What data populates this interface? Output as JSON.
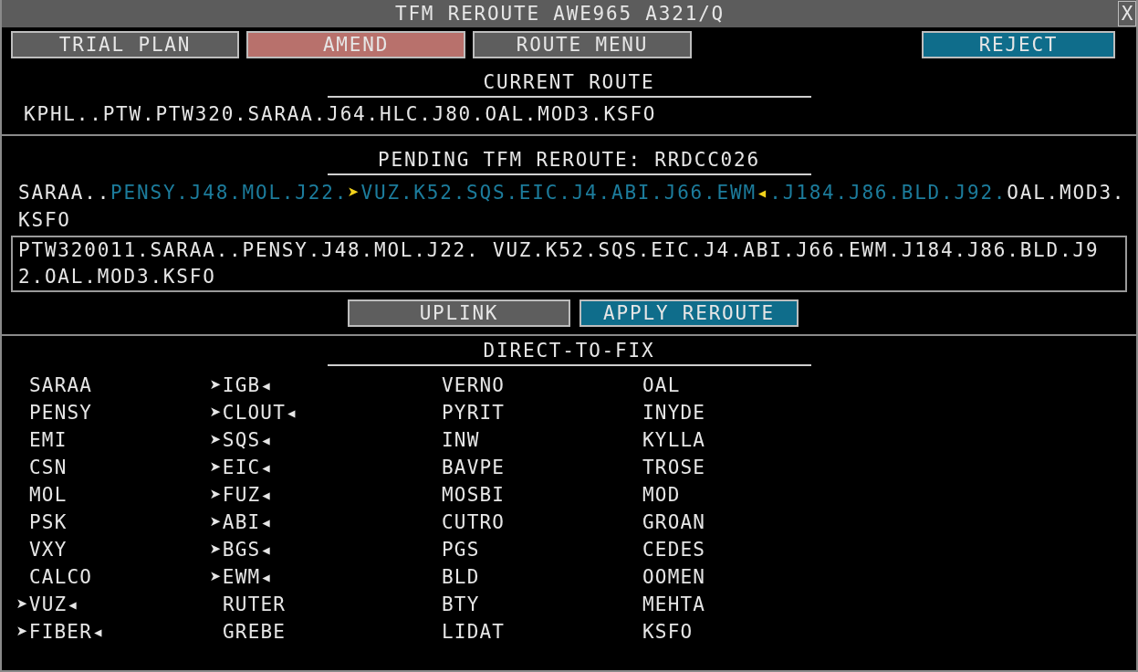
{
  "window": {
    "title": "TFM REROUTE AWE965 A321/Q",
    "close": "X"
  },
  "buttons": [
    {
      "label": "TRIAL PLAN",
      "kind": "grey"
    },
    {
      "label": "AMEND",
      "kind": "red"
    },
    {
      "label": "ROUTE MENU",
      "kind": "grey"
    },
    {
      "label": "REJECT",
      "kind": "blue"
    }
  ],
  "current_route": {
    "heading": "CURRENT ROUTE",
    "route": "KPHL..PTW.PTW320.SARAA.J64.HLC.J80.OAL.MOD3.KSFO"
  },
  "pending_reroute": {
    "heading": "PENDING TFM REROUTE: RRDCC026",
    "segments": [
      {
        "text": "SARAA..",
        "kind": "plain"
      },
      {
        "text": "PENSY.J48.MOL.J22.",
        "kind": "changed"
      },
      {
        "text": "➤",
        "kind": "mark"
      },
      {
        "text": "VUZ.K52.SQS.EIC.J4.ABI.J66.EWM",
        "kind": "changed"
      },
      {
        "text": "◂",
        "kind": "mark"
      },
      {
        "text": ".J184.J86.BLD.J92.",
        "kind": "changed"
      },
      {
        "text": "OAL.MOD3.KSFO",
        "kind": "plain"
      }
    ],
    "edit_field": "PTW320011.SARAA..PENSY.J48.MOL.J22. VUZ.K52.SQS.EIC.J4.ABI.J66.EWM.J184.J86.BLD.J92.OAL.MOD3.KSFO",
    "buttons": [
      {
        "label": "UPLINK",
        "kind": "grey"
      },
      {
        "label": "APPLY REROUTE",
        "kind": "blue"
      }
    ]
  },
  "direct_to_fix": {
    "heading": "DIRECT-TO-FIX",
    "columns": [
      [
        {
          "name": "SARAA",
          "marked": false
        },
        {
          "name": "PENSY",
          "marked": false
        },
        {
          "name": "EMI",
          "marked": false
        },
        {
          "name": "CSN",
          "marked": false
        },
        {
          "name": "MOL",
          "marked": false
        },
        {
          "name": "PSK",
          "marked": false
        },
        {
          "name": "VXY",
          "marked": false
        },
        {
          "name": "CALCO",
          "marked": false
        },
        {
          "name": "➤VUZ◂",
          "marked": true
        },
        {
          "name": "➤FIBER◂",
          "marked": true
        }
      ],
      [
        {
          "name": "➤IGB◂",
          "marked": true
        },
        {
          "name": "➤CLOUT◂",
          "marked": true
        },
        {
          "name": "➤SQS◂",
          "marked": true
        },
        {
          "name": "➤EIC◂",
          "marked": true
        },
        {
          "name": "➤FUZ◂",
          "marked": true
        },
        {
          "name": "➤ABI◂",
          "marked": true
        },
        {
          "name": "➤BGS◂",
          "marked": true
        },
        {
          "name": "➤EWM◂",
          "marked": true
        },
        {
          "name": "RUTER",
          "marked": false
        },
        {
          "name": "GREBE",
          "marked": false
        }
      ],
      [
        {
          "name": "VERNO",
          "marked": false
        },
        {
          "name": "PYRIT",
          "marked": false
        },
        {
          "name": "INW",
          "marked": false
        },
        {
          "name": "BAVPE",
          "marked": false
        },
        {
          "name": "MOSBI",
          "marked": false
        },
        {
          "name": "CUTRO",
          "marked": false
        },
        {
          "name": "PGS",
          "marked": false
        },
        {
          "name": "BLD",
          "marked": false
        },
        {
          "name": "BTY",
          "marked": false
        },
        {
          "name": "LIDAT",
          "marked": false
        }
      ],
      [
        {
          "name": "OAL",
          "marked": false
        },
        {
          "name": "INYDE",
          "marked": false
        },
        {
          "name": "KYLLA",
          "marked": false
        },
        {
          "name": "TROSE",
          "marked": false
        },
        {
          "name": "MOD",
          "marked": false
        },
        {
          "name": "GROAN",
          "marked": false
        },
        {
          "name": "CEDES",
          "marked": false
        },
        {
          "name": "OOMEN",
          "marked": false
        },
        {
          "name": "MEHTA",
          "marked": false
        },
        {
          "name": "KSFO",
          "marked": false
        }
      ]
    ]
  }
}
